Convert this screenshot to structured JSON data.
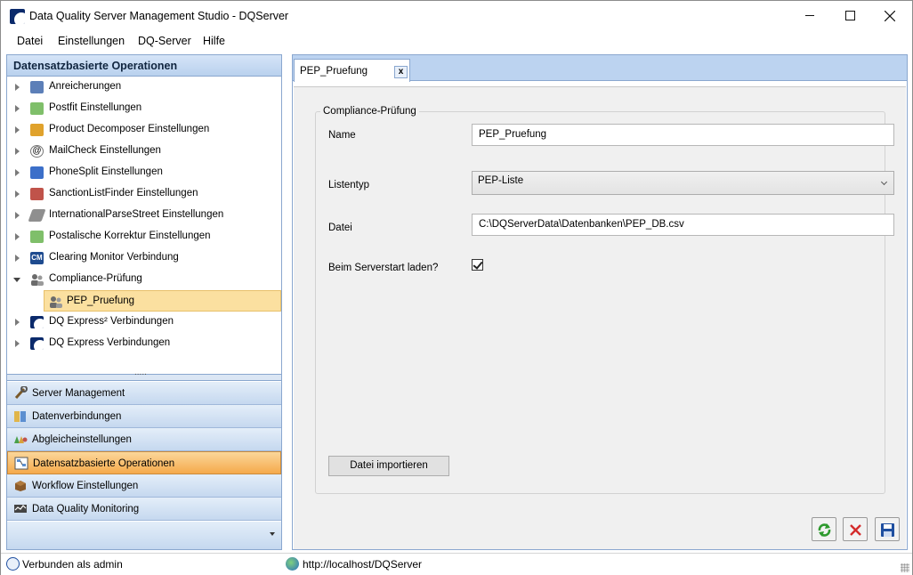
{
  "window": {
    "title": "Data Quality Server Management Studio - DQServer"
  },
  "menu": {
    "items": [
      "Datei",
      "Einstellungen",
      "DQ-Server",
      "Hilfe"
    ]
  },
  "left_panel": {
    "header": "Datensatzbasierte Operationen",
    "tree": [
      {
        "label": "Anreicherungen",
        "icon": "enrichment-icon",
        "color": "#5c7fb8"
      },
      {
        "label": "Postfit Einstellungen",
        "icon": "postfit-icon",
        "color": "#7fbf6a"
      },
      {
        "label": "Product Decomposer Einstellungen",
        "icon": "product-decomposer-icon",
        "color": "#e0a22c"
      },
      {
        "label": "MailCheck Einstellungen",
        "icon": "at-sign-icon",
        "color": "#b0b0b0"
      },
      {
        "label": "PhoneSplit Einstellungen",
        "icon": "phone-icon",
        "color": "#3c6fc9"
      },
      {
        "label": "SanctionListFinder Einstellungen",
        "icon": "sanction-list-icon",
        "color": "#c0534a"
      },
      {
        "label": "InternationalParseStreet Einstellungen",
        "icon": "street-icon",
        "color": "#8f8f8f"
      },
      {
        "label": "Postalische Korrektur Einstellungen",
        "icon": "postal-correction-icon",
        "color": "#7fbf6a"
      },
      {
        "label": "Clearing Monitor Verbindung",
        "icon": "cm-icon",
        "color": "#1e4b8f"
      },
      {
        "label": "Compliance-Prüfung",
        "icon": "users-icon",
        "color": "#6b6b6b"
      },
      {
        "label": "PEP_Pruefung",
        "icon": "users-icon",
        "color": "#6b6b6b"
      },
      {
        "label": "DQ Express² Verbindungen",
        "icon": "dq-express-icon",
        "color": "#0b2a6b"
      },
      {
        "label": "DQ Express Verbindungen",
        "icon": "dq-express-icon",
        "color": "#0b2a6b"
      }
    ],
    "cm_text": "CM",
    "nav": [
      {
        "label": "Server Management",
        "icon": "wrench-icon"
      },
      {
        "label": "Datenverbindungen",
        "icon": "database-icon"
      },
      {
        "label": "Abgleicheinstellungen",
        "icon": "match-settings-icon"
      },
      {
        "label": "Datensatzbasierte Operationen",
        "icon": "record-operations-icon"
      },
      {
        "label": "Workflow Einstellungen",
        "icon": "workflow-icon"
      },
      {
        "label": "Data Quality Monitoring",
        "icon": "monitoring-icon"
      }
    ]
  },
  "editor": {
    "tab_label": "PEP_Pruefung",
    "tab_close": "x",
    "group_title": "Compliance-Prüfung",
    "fields": {
      "name_label": "Name",
      "name_value": "PEP_Pruefung",
      "listtype_label": "Listentyp",
      "listtype_value": "PEP-Liste",
      "file_label": "Datei",
      "file_value": "C:\\DQServerData\\Datenbanken\\PEP_DB.csv",
      "autoload_label": "Beim Serverstart laden?",
      "autoload_checked": true
    },
    "import_button": "Datei importieren"
  },
  "status": {
    "connection": "Verbunden als admin",
    "url": "http://localhost/DQServer"
  },
  "colors": {
    "panel_border": "#8aa7cf",
    "nav_active": "#f5a94b",
    "tree_selected": "#fbe0a0",
    "refresh_green": "#2e9a2e",
    "cancel_red": "#d42a2a",
    "save_blue": "#1f4fa0"
  }
}
